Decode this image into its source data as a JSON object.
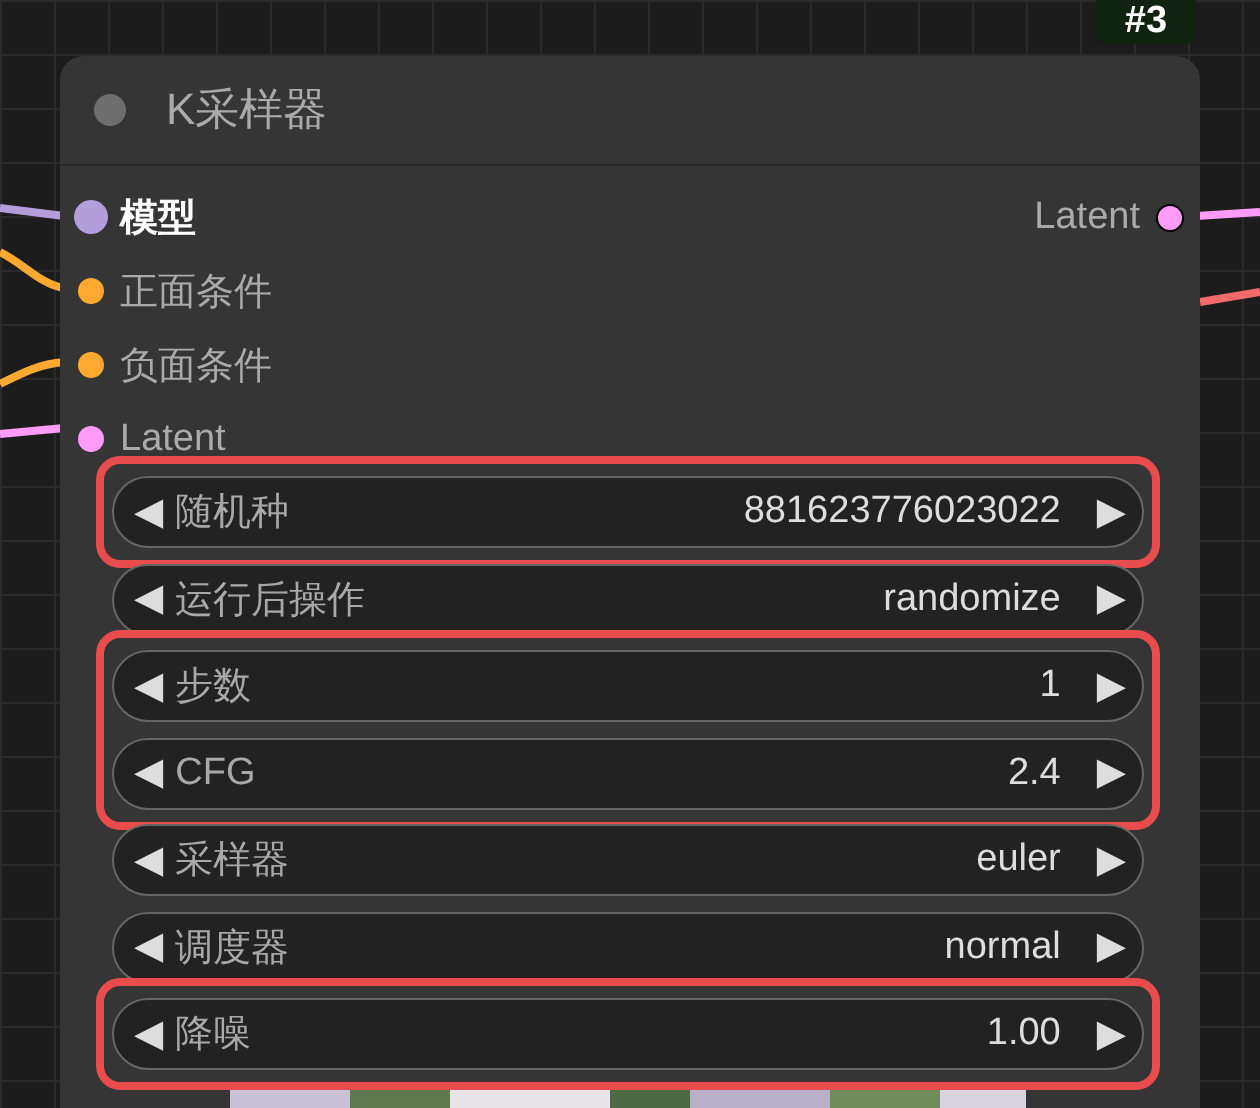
{
  "badge": "#3",
  "node": {
    "title": "K采样器",
    "inputs": [
      {
        "label": "模型",
        "color": "#b39ddb",
        "active": true
      },
      {
        "label": "正面条件",
        "color": "#ffa931",
        "active": false
      },
      {
        "label": "负面条件",
        "color": "#ffa931",
        "active": false
      },
      {
        "label": "Latent",
        "color": "#ff9cf9",
        "active": false
      }
    ],
    "outputs": [
      {
        "label": "Latent",
        "color": "#ff9cf9"
      }
    ],
    "widget_groups": [
      {
        "highlighted": true,
        "widgets": [
          {
            "left_arrow": "◀",
            "label": "随机种",
            "value": "881623776023022",
            "right_arrow": "▶"
          }
        ]
      },
      {
        "highlighted": false,
        "widgets": [
          {
            "left_arrow": "◀",
            "label": "运行后操作",
            "value": "randomize",
            "right_arrow": "▶"
          }
        ]
      },
      {
        "highlighted": true,
        "widgets": [
          {
            "left_arrow": "◀",
            "label": "步数",
            "value": "1",
            "right_arrow": "▶"
          },
          {
            "left_arrow": "◀",
            "label": "CFG",
            "value": "2.4",
            "right_arrow": "▶"
          }
        ]
      },
      {
        "highlighted": false,
        "widgets": [
          {
            "left_arrow": "◀",
            "label": "采样器",
            "value": "euler",
            "right_arrow": "▶"
          },
          {
            "left_arrow": "◀",
            "label": "调度器",
            "value": "normal",
            "right_arrow": "▶"
          }
        ]
      },
      {
        "highlighted": true,
        "widgets": [
          {
            "left_arrow": "◀",
            "label": "降噪",
            "value": "1.00",
            "right_arrow": "▶"
          }
        ]
      }
    ]
  }
}
